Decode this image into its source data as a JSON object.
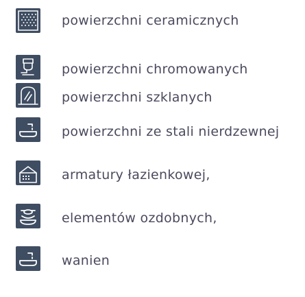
{
  "colors": {
    "icon_background": "#3f4d62",
    "icon_line": "#ffffff",
    "text": "#4a4a5e",
    "page_background": "#ffffff"
  },
  "items": [
    {
      "label": "powierzchni ceramicznych",
      "icon": "tile-pattern-icon"
    },
    {
      "label": "powierzchni chromowanych",
      "icon": "faucet-icon"
    },
    {
      "label": "powierzchni szklanych",
      "icon": "glass-shower-icon"
    },
    {
      "label": "powierzchni ze stali nierdzewnej",
      "icon": "sink-tap-icon"
    },
    {
      "label": "armatury łazienkowej,",
      "icon": "bathroom-fixtures-icon"
    },
    {
      "label": "elementów ozdobnych,",
      "icon": "decor-icon"
    },
    {
      "label": "wanien",
      "icon": "bathtub-icon"
    }
  ]
}
